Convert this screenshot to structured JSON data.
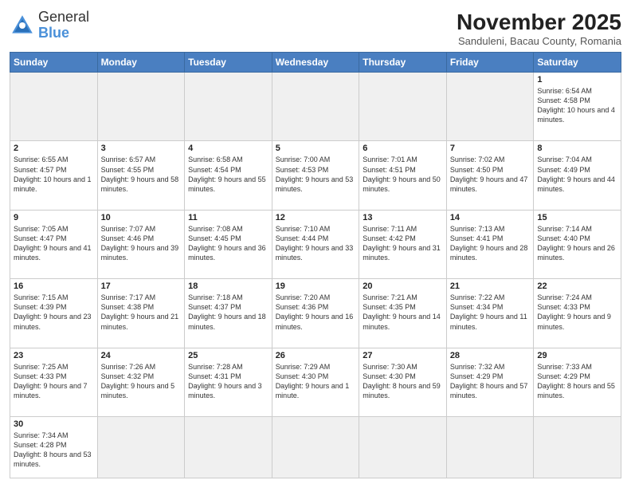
{
  "header": {
    "logo_general": "General",
    "logo_blue": "Blue",
    "month_title": "November 2025",
    "subtitle": "Sanduleni, Bacau County, Romania"
  },
  "days_of_week": [
    "Sunday",
    "Monday",
    "Tuesday",
    "Wednesday",
    "Thursday",
    "Friday",
    "Saturday"
  ],
  "weeks": [
    [
      {
        "day": "",
        "info": "",
        "empty": true
      },
      {
        "day": "",
        "info": "",
        "empty": true
      },
      {
        "day": "",
        "info": "",
        "empty": true
      },
      {
        "day": "",
        "info": "",
        "empty": true
      },
      {
        "day": "",
        "info": "",
        "empty": true
      },
      {
        "day": "",
        "info": "",
        "empty": true
      },
      {
        "day": "1",
        "info": "Sunrise: 6:54 AM\nSunset: 4:58 PM\nDaylight: 10 hours\nand 4 minutes."
      }
    ],
    [
      {
        "day": "2",
        "info": "Sunrise: 6:55 AM\nSunset: 4:57 PM\nDaylight: 10 hours\nand 1 minute."
      },
      {
        "day": "3",
        "info": "Sunrise: 6:57 AM\nSunset: 4:55 PM\nDaylight: 9 hours\nand 58 minutes."
      },
      {
        "day": "4",
        "info": "Sunrise: 6:58 AM\nSunset: 4:54 PM\nDaylight: 9 hours\nand 55 minutes."
      },
      {
        "day": "5",
        "info": "Sunrise: 7:00 AM\nSunset: 4:53 PM\nDaylight: 9 hours\nand 53 minutes."
      },
      {
        "day": "6",
        "info": "Sunrise: 7:01 AM\nSunset: 4:51 PM\nDaylight: 9 hours\nand 50 minutes."
      },
      {
        "day": "7",
        "info": "Sunrise: 7:02 AM\nSunset: 4:50 PM\nDaylight: 9 hours\nand 47 minutes."
      },
      {
        "day": "8",
        "info": "Sunrise: 7:04 AM\nSunset: 4:49 PM\nDaylight: 9 hours\nand 44 minutes."
      }
    ],
    [
      {
        "day": "9",
        "info": "Sunrise: 7:05 AM\nSunset: 4:47 PM\nDaylight: 9 hours\nand 41 minutes."
      },
      {
        "day": "10",
        "info": "Sunrise: 7:07 AM\nSunset: 4:46 PM\nDaylight: 9 hours\nand 39 minutes."
      },
      {
        "day": "11",
        "info": "Sunrise: 7:08 AM\nSunset: 4:45 PM\nDaylight: 9 hours\nand 36 minutes."
      },
      {
        "day": "12",
        "info": "Sunrise: 7:10 AM\nSunset: 4:44 PM\nDaylight: 9 hours\nand 33 minutes."
      },
      {
        "day": "13",
        "info": "Sunrise: 7:11 AM\nSunset: 4:42 PM\nDaylight: 9 hours\nand 31 minutes."
      },
      {
        "day": "14",
        "info": "Sunrise: 7:13 AM\nSunset: 4:41 PM\nDaylight: 9 hours\nand 28 minutes."
      },
      {
        "day": "15",
        "info": "Sunrise: 7:14 AM\nSunset: 4:40 PM\nDaylight: 9 hours\nand 26 minutes."
      }
    ],
    [
      {
        "day": "16",
        "info": "Sunrise: 7:15 AM\nSunset: 4:39 PM\nDaylight: 9 hours\nand 23 minutes."
      },
      {
        "day": "17",
        "info": "Sunrise: 7:17 AM\nSunset: 4:38 PM\nDaylight: 9 hours\nand 21 minutes."
      },
      {
        "day": "18",
        "info": "Sunrise: 7:18 AM\nSunset: 4:37 PM\nDaylight: 9 hours\nand 18 minutes."
      },
      {
        "day": "19",
        "info": "Sunrise: 7:20 AM\nSunset: 4:36 PM\nDaylight: 9 hours\nand 16 minutes."
      },
      {
        "day": "20",
        "info": "Sunrise: 7:21 AM\nSunset: 4:35 PM\nDaylight: 9 hours\nand 14 minutes."
      },
      {
        "day": "21",
        "info": "Sunrise: 7:22 AM\nSunset: 4:34 PM\nDaylight: 9 hours\nand 11 minutes."
      },
      {
        "day": "22",
        "info": "Sunrise: 7:24 AM\nSunset: 4:33 PM\nDaylight: 9 hours\nand 9 minutes."
      }
    ],
    [
      {
        "day": "23",
        "info": "Sunrise: 7:25 AM\nSunset: 4:33 PM\nDaylight: 9 hours\nand 7 minutes."
      },
      {
        "day": "24",
        "info": "Sunrise: 7:26 AM\nSunset: 4:32 PM\nDaylight: 9 hours\nand 5 minutes."
      },
      {
        "day": "25",
        "info": "Sunrise: 7:28 AM\nSunset: 4:31 PM\nDaylight: 9 hours\nand 3 minutes."
      },
      {
        "day": "26",
        "info": "Sunrise: 7:29 AM\nSunset: 4:30 PM\nDaylight: 9 hours\nand 1 minute."
      },
      {
        "day": "27",
        "info": "Sunrise: 7:30 AM\nSunset: 4:30 PM\nDaylight: 8 hours\nand 59 minutes."
      },
      {
        "day": "28",
        "info": "Sunrise: 7:32 AM\nSunset: 4:29 PM\nDaylight: 8 hours\nand 57 minutes."
      },
      {
        "day": "29",
        "info": "Sunrise: 7:33 AM\nSunset: 4:29 PM\nDaylight: 8 hours\nand 55 minutes."
      }
    ],
    [
      {
        "day": "30",
        "info": "Sunrise: 7:34 AM\nSunset: 4:28 PM\nDaylight: 8 hours\nand 53 minutes.",
        "last": true
      },
      {
        "day": "",
        "info": "",
        "empty": true,
        "last": true
      },
      {
        "day": "",
        "info": "",
        "empty": true,
        "last": true
      },
      {
        "day": "",
        "info": "",
        "empty": true,
        "last": true
      },
      {
        "day": "",
        "info": "",
        "empty": true,
        "last": true
      },
      {
        "day": "",
        "info": "",
        "empty": true,
        "last": true
      },
      {
        "day": "",
        "info": "",
        "empty": true,
        "last": true
      }
    ]
  ]
}
